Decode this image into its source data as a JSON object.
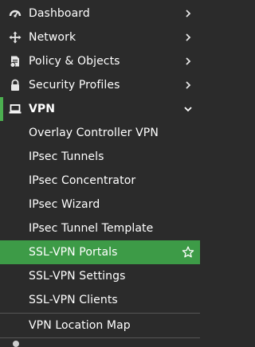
{
  "nav": {
    "top_items": [
      {
        "label": "Dashboard",
        "icon": "dashboard-icon"
      },
      {
        "label": "Network",
        "icon": "network-move-icon"
      },
      {
        "label": "Policy & Objects",
        "icon": "policy-objects-icon"
      },
      {
        "label": "Security Profiles",
        "icon": "lock-icon"
      }
    ],
    "vpn": {
      "label": "VPN",
      "icon": "laptop-icon"
    },
    "sub_items": [
      {
        "label": "Overlay Controller VPN"
      },
      {
        "label": "IPsec Tunnels"
      },
      {
        "label": "IPsec Concentrator"
      },
      {
        "label": "IPsec Wizard"
      },
      {
        "label": "IPsec Tunnel Template"
      },
      {
        "label": "SSL-VPN Portals"
      },
      {
        "label": "SSL-VPN Settings"
      },
      {
        "label": "SSL-VPN Clients"
      },
      {
        "label": "VPN Location Map"
      }
    ]
  },
  "colors": {
    "sidebar_bg": "#2b2b2b",
    "active_bg": "#3d9b47",
    "accent": "#4caf50",
    "text": "#ffffff"
  }
}
